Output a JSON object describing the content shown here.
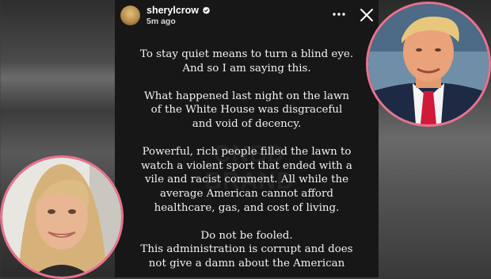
{
  "header": {
    "username": "sherylcrow",
    "time": "5m ago",
    "verified_icon": "verified-badge-icon",
    "more_icon": "more-options-icon",
    "close_icon": "close-icon"
  },
  "watermark": [
    "CNBD",
    "BRAND"
  ],
  "story": {
    "paragraphs": [
      [
        "To stay quiet means to turn a blind eye.",
        "And so I am saying this."
      ],
      [
        "What happened last night on the lawn",
        "of the White House was disgraceful",
        "and void of decency."
      ],
      [
        "Powerful, rich people filled the lawn to",
        "watch a violent sport that ended with a",
        "vile and racist comment. All while the",
        "average American cannot afford",
        "healthcare, gas, and cost of living."
      ],
      [
        "Do not be fooled.",
        "This administration is corrupt and does",
        "not give a damn about the American"
      ]
    ]
  },
  "photos": {
    "right": "man-portrait-photo",
    "left": "woman-portrait-photo",
    "border_color": "#e9728d"
  },
  "colors": {
    "story_bg": "#171717",
    "text": "#f2f2f2"
  }
}
